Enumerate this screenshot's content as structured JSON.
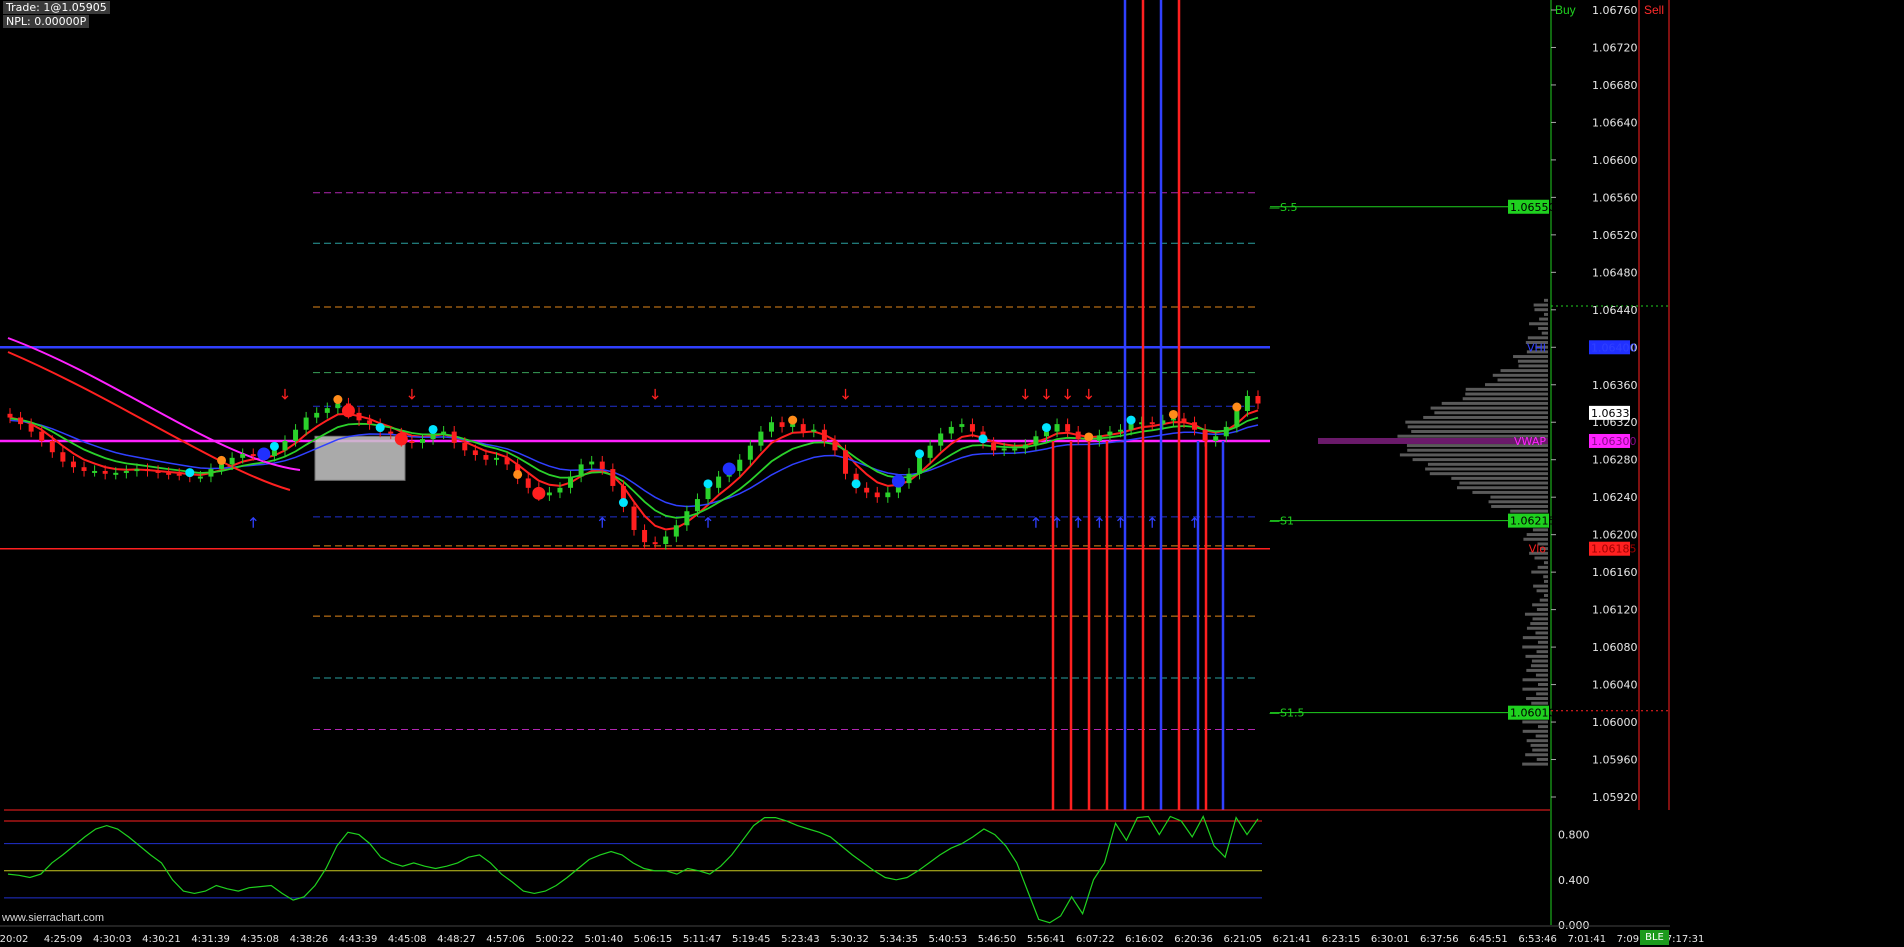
{
  "window": {
    "trade_text": "Trade: 1@1.05905",
    "npl_text": "NPL: 0.00000P",
    "buy_header": "Buy",
    "sell_header": "Sell",
    "credit": "www.sierrachart.com",
    "status_badge": "BLE"
  },
  "colors": {
    "background": "#000000",
    "up_candle": "#2bd12b",
    "down_candle": "#ff1f1f",
    "vwap": "#ff22ff",
    "ema_red": "#ff2020",
    "ema_blue": "#3040ff",
    "ema_green": "#2bd12b",
    "pivot_line": "#1fd11f",
    "oscillator": "#1fd11f",
    "profile": "#5a5a5a"
  },
  "chart_data": {
    "type": "candlestick",
    "symbol_price_scale": {
      "ylim": [
        1.059,
        1.0678
      ],
      "tick_labels": [
        "1.06760",
        "1.06720",
        "1.06680",
        "1.06640",
        "1.06600",
        "1.06560",
        "1.06520",
        "1.06480",
        "1.06440",
        "1.06400",
        "1.06360",
        "1.06320",
        "1.06280",
        "1.06240",
        "1.06200",
        "1.06160",
        "1.06120",
        "1.06080",
        "1.06040",
        "1.06000",
        "1.05960",
        "1.05920"
      ],
      "ticks": [
        1.0676,
        1.0672,
        1.0668,
        1.0664,
        1.066,
        1.0656,
        1.0652,
        1.0648,
        1.0644,
        1.064,
        1.0636,
        1.0632,
        1.0628,
        1.0624,
        1.062,
        1.0616,
        1.0612,
        1.0608,
        1.0604,
        1.06,
        1.0596,
        1.0592
      ]
    },
    "time_labels": [
      "20:02",
      "4:25:09",
      "4:30:03",
      "4:30:21",
      "4:31:39",
      "4:35:08",
      "4:38:26",
      "4:43:39",
      "4:45:08",
      "4:48:27",
      "4:57:06",
      "5:00:22",
      "5:01:40",
      "5:06:15",
      "5:11:47",
      "5:19:45",
      "5:23:43",
      "5:30:32",
      "5:34:35",
      "5:40:53",
      "5:46:50",
      "5:56:41",
      "6:07:22",
      "6:16:02",
      "6:20:36",
      "6:21:05",
      "6:21:41",
      "6:23:15",
      "6:30:01",
      "6:37:56",
      "6:45:51",
      "6:53:46",
      "7:01:41",
      "7:09:36",
      "7:17:31"
    ],
    "last_candle_index": 28,
    "candles_close": [
      1.06325,
      1.06318,
      1.0631,
      1.063,
      1.06288,
      1.06278,
      1.06272,
      1.06268,
      1.06268,
      1.06265,
      1.06266,
      1.06268,
      1.0627,
      1.06268,
      1.06266,
      1.06265,
      1.06264,
      1.06262,
      1.06262,
      1.0627,
      1.06275,
      1.06282,
      1.06286,
      1.06285,
      1.06284,
      1.0629,
      1.063,
      1.06312,
      1.06325,
      1.0633,
      1.06335,
      1.0634,
      1.0633,
      1.06322,
      1.06318,
      1.0631,
      1.06308,
      1.063,
      1.06298,
      1.06302,
      1.06308,
      1.0631,
      1.06298,
      1.0629,
      1.06285,
      1.0628,
      1.06282,
      1.06275,
      1.0626,
      1.0625,
      1.06242,
      1.06245,
      1.0625,
      1.06262,
      1.06275,
      1.06278,
      1.0627,
      1.06252,
      1.0623,
      1.06205,
      1.06192,
      1.0619,
      1.06198,
      1.0621,
      1.06225,
      1.06238,
      1.0625,
      1.06262,
      1.06268,
      1.0628,
      1.06295,
      1.0631,
      1.0632,
      1.06315,
      1.06318,
      1.0631,
      1.06312,
      1.063,
      1.0629,
      1.06265,
      1.0625,
      1.06245,
      1.0624,
      1.06245,
      1.06255,
      1.06265,
      1.06282,
      1.06295,
      1.06308,
      1.06315,
      1.06318,
      1.0631,
      1.06298,
      1.0629,
      1.06292,
      1.06292,
      1.06296,
      1.06305,
      1.0631,
      1.06318,
      1.0631,
      1.06302,
      1.063,
      1.06306,
      1.0631,
      1.06312,
      1.06318,
      1.0632,
      1.06318,
      1.06322,
      1.06324,
      1.0632,
      1.06312,
      1.063,
      1.06305,
      1.06315,
      1.06332,
      1.06348,
      1.0634
    ],
    "overlays": {
      "vwap": 1.063,
      "vhi": 1.064,
      "vlo": 1.06185,
      "poc_profile_peak": 1.063
    },
    "pivot_levels": [
      {
        "name": "S.5",
        "value": 1.0655
      },
      {
        "name": "S1",
        "value": 1.06215
      },
      {
        "name": "S1.5",
        "value": 1.0601
      }
    ],
    "price_tags": [
      {
        "text": "1.06550",
        "value": 1.0655,
        "bg": "#1fd11f",
        "fg": "#000000"
      },
      {
        "text": "1.06400",
        "value": 1.064,
        "bg": "#2030ff",
        "fg": "#3040ff"
      },
      {
        "text": "1.06330",
        "value": 1.0633,
        "bg": "#ffffff",
        "fg": "#000000"
      },
      {
        "text": "1.06300",
        "value": 1.063,
        "bg": "#ff22ff",
        "fg": "#8a0a8a"
      },
      {
        "text": "1.06215",
        "value": 1.06215,
        "bg": "#1fd11f",
        "fg": "#000000"
      },
      {
        "text": "1.06185",
        "value": 1.06185,
        "bg": "#ff2020",
        "fg": "#a00000"
      },
      {
        "text": "1.06010",
        "value": 1.0601,
        "bg": "#1fd11f",
        "fg": "#000000"
      }
    ],
    "level_tags": [
      {
        "text": "VHI",
        "value": 1.064,
        "color": "#3040ff"
      },
      {
        "text": "VWAP",
        "value": 1.063,
        "color": "#ff22ff"
      },
      {
        "text": "Vlo",
        "value": 1.06185,
        "color": "#ff2020"
      }
    ],
    "fib_levels": [
      {
        "value": 1.06565,
        "color": "#b026b0"
      },
      {
        "value": 1.06511,
        "color": "#2aa0a0"
      },
      {
        "value": 1.06443,
        "color": "#e0861a"
      },
      {
        "value": 1.06373,
        "color": "#3aa05a"
      },
      {
        "value": 1.06337,
        "color": "#2030d0"
      },
      {
        "value": 1.06219,
        "color": "#2030d0"
      },
      {
        "value": 1.06188,
        "color": "#e0861a"
      },
      {
        "value": 1.06113,
        "color": "#e0861a"
      },
      {
        "value": 1.06047,
        "color": "#2aa0a0"
      },
      {
        "value": 1.05992,
        "color": "#b026b0"
      }
    ],
    "oscillator": {
      "ylim": [
        0,
        1.0
      ],
      "tick_labels": [
        "0.800",
        "0.400",
        "0.000"
      ],
      "ticks": [
        0.8,
        0.4,
        0.0
      ],
      "guide_levels": [
        0.92,
        0.72,
        0.48,
        0.24
      ],
      "values": [
        0.45,
        0.44,
        0.42,
        0.45,
        0.55,
        0.62,
        0.7,
        0.78,
        0.85,
        0.88,
        0.85,
        0.78,
        0.7,
        0.62,
        0.55,
        0.4,
        0.3,
        0.28,
        0.3,
        0.35,
        0.32,
        0.3,
        0.33,
        0.34,
        0.35,
        0.28,
        0.22,
        0.25,
        0.35,
        0.5,
        0.7,
        0.82,
        0.8,
        0.72,
        0.6,
        0.55,
        0.52,
        0.55,
        0.52,
        0.5,
        0.52,
        0.55,
        0.6,
        0.62,
        0.55,
        0.45,
        0.38,
        0.3,
        0.28,
        0.3,
        0.35,
        0.42,
        0.5,
        0.58,
        0.62,
        0.65,
        0.62,
        0.55,
        0.5,
        0.48,
        0.48,
        0.45,
        0.5,
        0.48,
        0.45,
        0.52,
        0.62,
        0.75,
        0.88,
        0.95,
        0.95,
        0.92,
        0.88,
        0.85,
        0.82,
        0.78,
        0.7,
        0.62,
        0.55,
        0.48,
        0.42,
        0.4,
        0.42,
        0.48,
        0.55,
        0.62,
        0.68,
        0.72,
        0.78,
        0.85,
        0.8,
        0.7,
        0.55,
        0.3,
        0.05,
        0.02,
        0.08,
        0.25,
        0.1,
        0.4,
        0.55,
        0.9,
        0.75,
        0.95,
        0.96,
        0.8,
        0.96,
        0.92,
        0.78,
        0.96,
        0.7,
        0.6,
        0.95,
        0.8,
        0.94
      ]
    }
  }
}
